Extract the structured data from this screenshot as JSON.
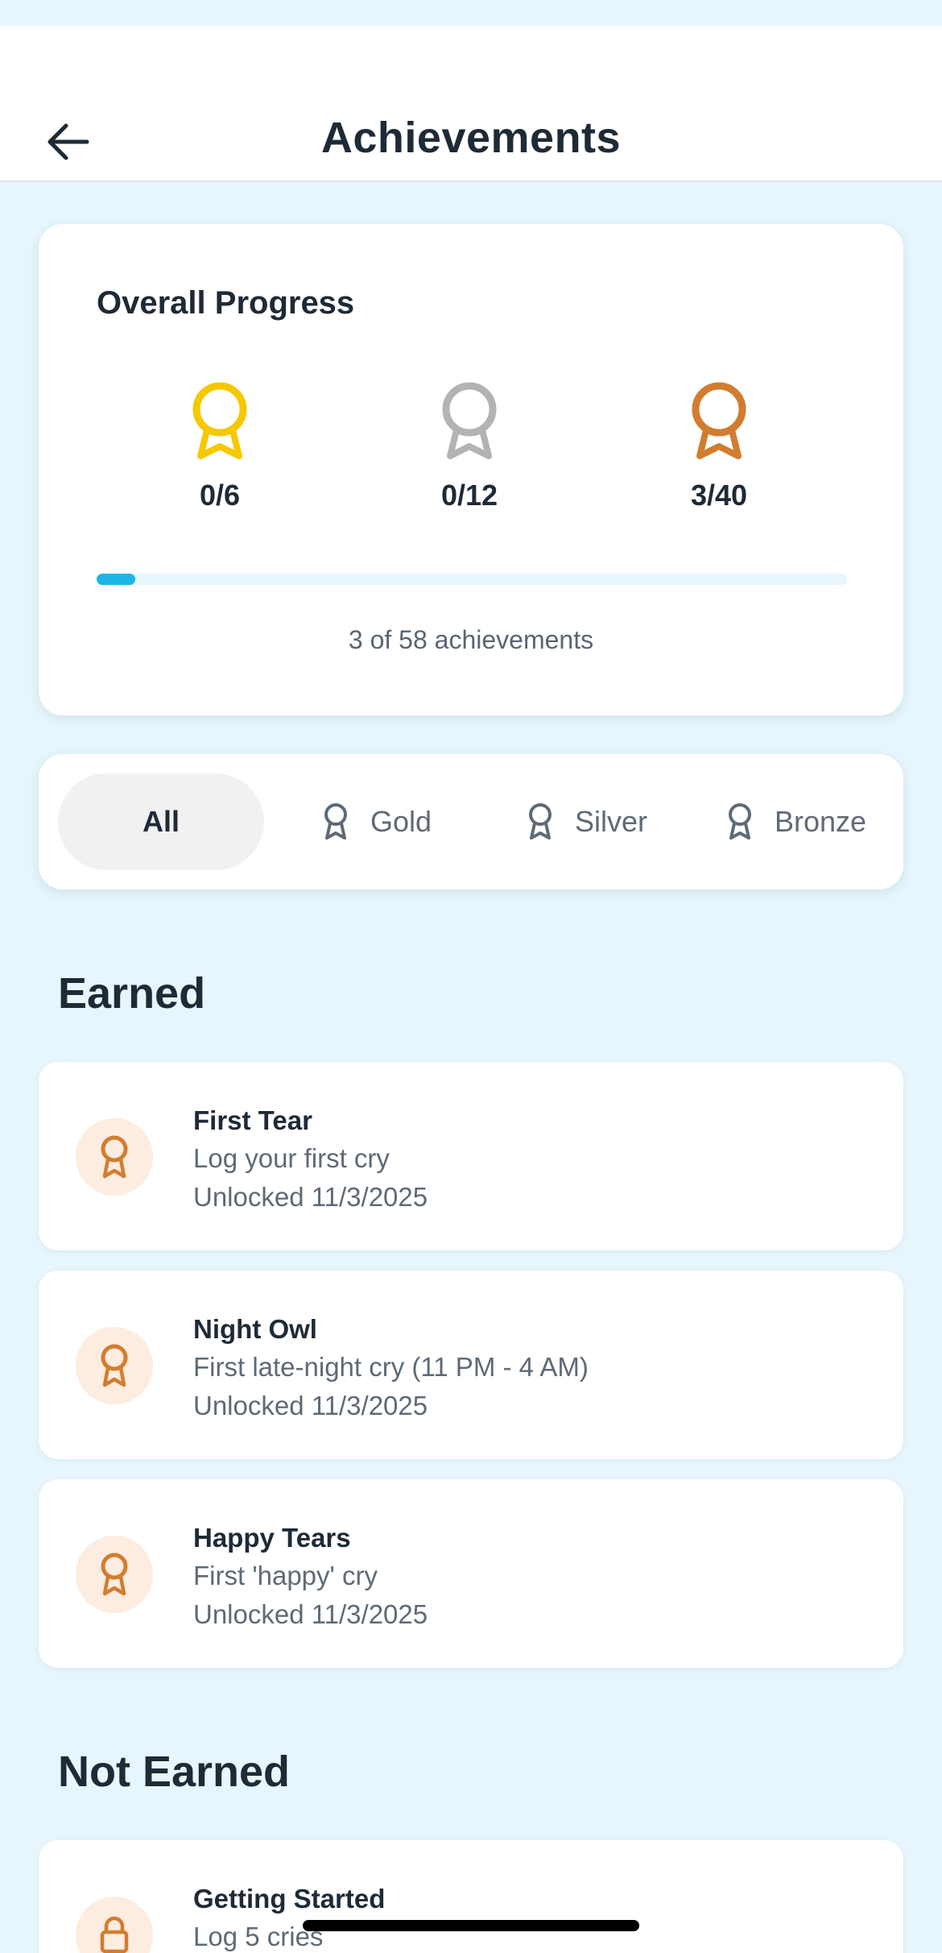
{
  "header": {
    "title": "Achievements"
  },
  "progress": {
    "title": "Overall Progress",
    "gold_count": "0/6",
    "silver_count": "0/12",
    "bronze_count": "3/40",
    "fraction": 0.052,
    "caption": "3 of 58 achievements"
  },
  "filters": {
    "all": "All",
    "gold": "Gold",
    "silver": "Silver",
    "bronze": "Bronze",
    "selected": "All"
  },
  "colors": {
    "gold": "#f5c800",
    "silver": "#b3b3b3",
    "bronze": "#d27d2d",
    "accent": "#1eb4e6",
    "background": "#e6f6fc"
  },
  "earned": {
    "heading": "Earned",
    "items": [
      {
        "title": "First Tear",
        "description": "Log your first cry",
        "date": "Unlocked 11/3/2025",
        "icon": "bronze-medal-icon"
      },
      {
        "title": "Night Owl",
        "description": "First late-night cry (11 PM - 4 AM)",
        "date": "Unlocked 11/3/2025",
        "icon": "bronze-medal-icon"
      },
      {
        "title": "Happy Tears",
        "description": "First 'happy' cry",
        "date": "Unlocked 11/3/2025",
        "icon": "bronze-medal-icon"
      }
    ]
  },
  "not_earned": {
    "heading": "Not Earned",
    "items": [
      {
        "title": "Getting Started",
        "description": "Log 5 cries",
        "icon": "lock-icon"
      }
    ]
  }
}
